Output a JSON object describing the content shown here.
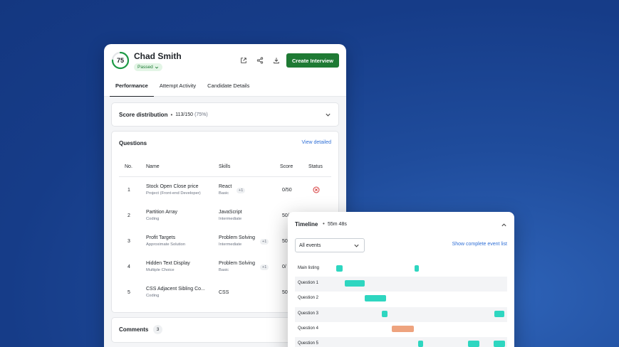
{
  "candidate": {
    "score": "75",
    "score_fraction": 0.75,
    "name": "Chad Smith",
    "status_badge": "Passed"
  },
  "header": {
    "create_button": "Create Interview",
    "icons": [
      "external-link-icon",
      "share-icon",
      "download-icon"
    ]
  },
  "tabs": [
    {
      "label": "Performance",
      "active": true
    },
    {
      "label": "Attempt Activity",
      "active": false
    },
    {
      "label": "Candidate Details",
      "active": false
    }
  ],
  "score_distribution": {
    "title": "Score distribution",
    "separator": "•",
    "score": "113/150",
    "percent": "(75%)"
  },
  "questions": {
    "title": "Questions",
    "view_link": "View detailed",
    "columns": [
      "No.",
      "Name",
      "Skills",
      "Score",
      "Status"
    ],
    "rows": [
      {
        "no": "1",
        "name": "Stock Open Close price",
        "type": "Project (Front-end Developer)",
        "skill": "React",
        "level": "Basic",
        "extra": "+1",
        "score": "0/50",
        "status": "failed"
      },
      {
        "no": "2",
        "name": "Partition Array",
        "type": "Coding",
        "skill": "JavaScript",
        "level": "Intermediate",
        "extra": "",
        "score": "50/",
        "status": ""
      },
      {
        "no": "3",
        "name": "Profit Targets",
        "type": "Approximate Solution",
        "skill": "Problem Solving",
        "level": "Intermediate",
        "extra": "+1",
        "score": "50.",
        "status": ""
      },
      {
        "no": "4",
        "name": "Hidden Text Display",
        "type": "Multiple Choice",
        "skill": "Problem Solving",
        "level": "Basic",
        "extra": "+1",
        "score": "0/",
        "status": ""
      },
      {
        "no": "5",
        "name": "CSS Adjacent Sibling Co...",
        "type": "Coding",
        "skill": "CSS",
        "level": "",
        "extra": "",
        "score": "50.",
        "status": ""
      }
    ]
  },
  "comments": {
    "title": "Comments",
    "count": "3"
  },
  "timeline": {
    "title": "Timeline",
    "separator": "•",
    "duration": "55m 48s",
    "filter_value": "All events",
    "link": "Show complete event list",
    "colors": {
      "normal": "#2ed6c0",
      "highlight": "#eea37e"
    },
    "rows": [
      {
        "label": "Main listing",
        "bars": [
          [
            0.195,
            0.225,
            "normal"
          ],
          [
            0.565,
            0.585,
            "normal"
          ]
        ]
      },
      {
        "label": "Question 1",
        "bars": [
          [
            0.235,
            0.33,
            "normal"
          ]
        ]
      },
      {
        "label": "Question 2",
        "bars": [
          [
            0.33,
            0.43,
            "normal"
          ]
        ]
      },
      {
        "label": "Question 3",
        "bars": [
          [
            0.41,
            0.435,
            "normal"
          ],
          [
            0.94,
            0.985,
            "normal"
          ]
        ]
      },
      {
        "label": "Question 4",
        "bars": [
          [
            0.455,
            0.56,
            "highlight"
          ]
        ]
      },
      {
        "label": "Question 5",
        "bars": [
          [
            0.58,
            0.605,
            "normal"
          ],
          [
            0.815,
            0.87,
            "normal"
          ],
          [
            0.935,
            0.99,
            "normal"
          ]
        ]
      }
    ]
  }
}
